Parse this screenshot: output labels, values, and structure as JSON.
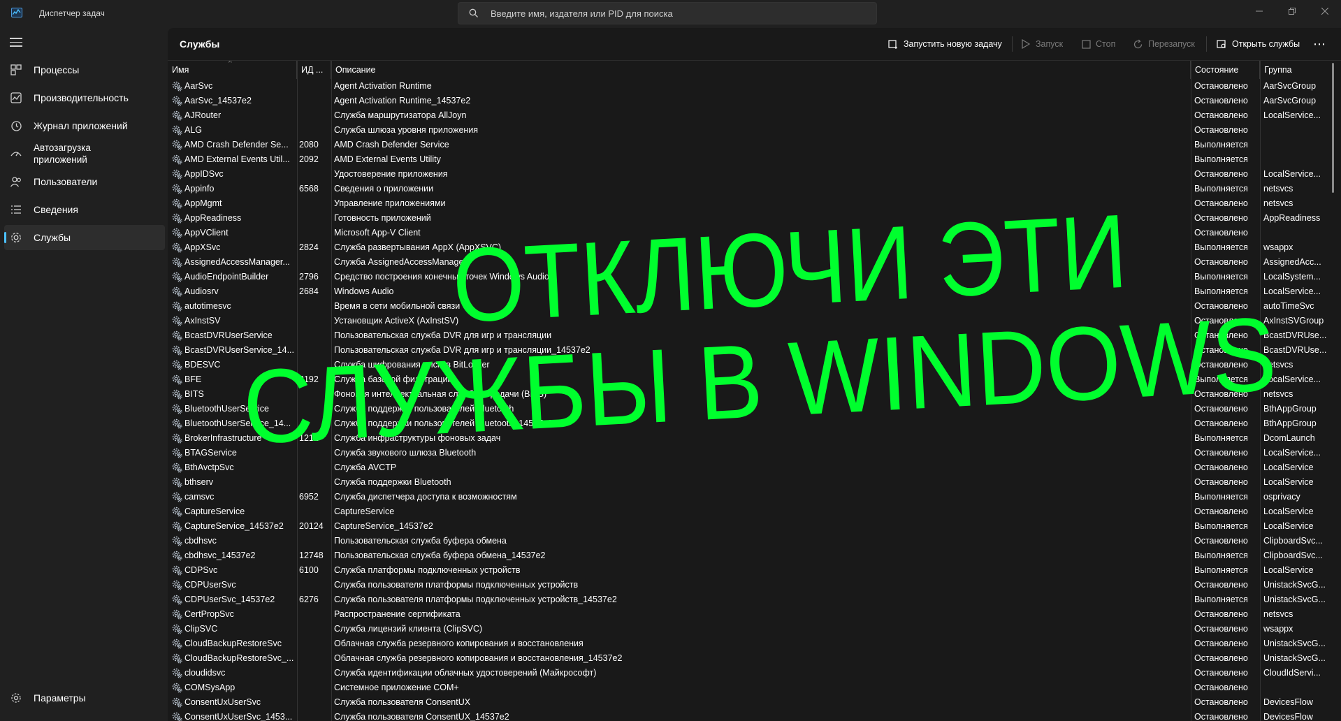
{
  "titlebar": {
    "app_title": "Диспетчер задач",
    "search_placeholder": "Введите имя, издателя или PID для поиска"
  },
  "sidebar": {
    "items": [
      {
        "label": "Процессы",
        "icon": "processes-icon"
      },
      {
        "label": "Производительность",
        "icon": "performance-icon"
      },
      {
        "label": "Журнал приложений",
        "icon": "app-history-icon"
      },
      {
        "label": "Автозагрузка приложений",
        "icon": "startup-icon"
      },
      {
        "label": "Пользователи",
        "icon": "users-icon"
      },
      {
        "label": "Сведения",
        "icon": "details-icon"
      },
      {
        "label": "Службы",
        "icon": "services-icon"
      }
    ],
    "settings_label": "Параметры"
  },
  "toolbar": {
    "title": "Службы",
    "run_new_task": "Запустить новую задачу",
    "start": "Запуск",
    "stop": "Стоп",
    "restart": "Перезапуск",
    "open_services": "Открыть службы",
    "more": "⋯"
  },
  "table": {
    "columns": [
      "Имя",
      "ИД ...",
      "Описание",
      "Состояние",
      "Группа"
    ],
    "rows": [
      [
        "AarSvc",
        "",
        "Agent Activation Runtime",
        "Остановлено",
        "AarSvcGroup"
      ],
      [
        "AarSvc_14537e2",
        "",
        "Agent Activation Runtime_14537e2",
        "Остановлено",
        "AarSvcGroup"
      ],
      [
        "AJRouter",
        "",
        "Служба маршрутизатора AllJoyn",
        "Остановлено",
        "LocalService..."
      ],
      [
        "ALG",
        "",
        "Служба шлюза уровня приложения",
        "Остановлено",
        ""
      ],
      [
        "AMD Crash Defender Se...",
        "2080",
        "AMD Crash Defender Service",
        "Выполняется",
        ""
      ],
      [
        "AMD External Events Util...",
        "2092",
        "AMD External Events Utility",
        "Выполняется",
        ""
      ],
      [
        "AppIDSvc",
        "",
        "Удостоверение приложения",
        "Остановлено",
        "LocalService..."
      ],
      [
        "Appinfo",
        "6568",
        "Сведения о приложении",
        "Выполняется",
        "netsvcs"
      ],
      [
        "AppMgmt",
        "",
        "Управление приложениями",
        "Остановлено",
        "netsvcs"
      ],
      [
        "AppReadiness",
        "",
        "Готовность приложений",
        "Остановлено",
        "AppReadiness"
      ],
      [
        "AppVClient",
        "",
        "Microsoft App-V Client",
        "Остановлено",
        ""
      ],
      [
        "AppXSvc",
        "2824",
        "Служба развертывания AppX (AppXSVC)",
        "Выполняется",
        "wsappx"
      ],
      [
        "AssignedAccessManager...",
        "",
        "Служба AssignedAccessManager",
        "Остановлено",
        "AssignedAcc..."
      ],
      [
        "AudioEndpointBuilder",
        "2796",
        "Средство построения конечных точек Windows Audio",
        "Выполняется",
        "LocalSystem..."
      ],
      [
        "Audiosrv",
        "2684",
        "Windows Audio",
        "Выполняется",
        "LocalService..."
      ],
      [
        "autotimesvc",
        "",
        "Время в сети мобильной связи",
        "Остановлено",
        "autoTimeSvc"
      ],
      [
        "AxInstSV",
        "",
        "Установщик ActiveX (AxInstSV)",
        "Остановлено",
        "AxInstSVGroup"
      ],
      [
        "BcastDVRUserService",
        "",
        "Пользовательская служба DVR для игр и трансляции",
        "Остановлено",
        "BcastDVRUse..."
      ],
      [
        "BcastDVRUserService_14...",
        "",
        "Пользовательская служба DVR для игр и трансляции_14537e2",
        "Остановлено",
        "BcastDVRUse..."
      ],
      [
        "BDESVC",
        "",
        "Служба шифрования дисков BitLocker",
        "Остановлено",
        "netsvcs"
      ],
      [
        "BFE",
        "3192",
        "Служба базовой фильтрации",
        "Выполняется",
        "LocalService..."
      ],
      [
        "BITS",
        "",
        "Фоновая интеллектуальная служба передачи (BITS)",
        "Остановлено",
        "netsvcs"
      ],
      [
        "BluetoothUserService",
        "",
        "Служба поддержки пользователей Bluetooth",
        "Остановлено",
        "BthAppGroup"
      ],
      [
        "BluetoothUserService_14...",
        "",
        "Служба поддержки пользователей Bluetooth_14537e2",
        "Остановлено",
        "BthAppGroup"
      ],
      [
        "BrokerInfrastructure",
        "1212",
        "Служба инфраструктуры фоновых задач",
        "Выполняется",
        "DcomLaunch"
      ],
      [
        "BTAGService",
        "",
        "Служба звукового шлюза Bluetooth",
        "Остановлено",
        "LocalService..."
      ],
      [
        "BthAvctpSvc",
        "",
        "Служба AVCTP",
        "Остановлено",
        "LocalService"
      ],
      [
        "bthserv",
        "",
        "Служба поддержки Bluetooth",
        "Остановлено",
        "LocalService"
      ],
      [
        "camsvc",
        "6952",
        "Служба диспетчера доступа к возможностям",
        "Выполняется",
        "osprivacy"
      ],
      [
        "CaptureService",
        "",
        "CaptureService",
        "Остановлено",
        "LocalService"
      ],
      [
        "CaptureService_14537e2",
        "20124",
        "CaptureService_14537e2",
        "Выполняется",
        "LocalService"
      ],
      [
        "cbdhsvc",
        "",
        "Пользовательская служба буфера обмена",
        "Остановлено",
        "ClipboardSvc..."
      ],
      [
        "cbdhsvc_14537e2",
        "12748",
        "Пользовательская служба буфера обмена_14537e2",
        "Выполняется",
        "ClipboardSvc..."
      ],
      [
        "CDPSvc",
        "6100",
        "Служба платформы подключенных устройств",
        "Выполняется",
        "LocalService"
      ],
      [
        "CDPUserSvc",
        "",
        "Служба пользователя платформы подключенных устройств",
        "Остановлено",
        "UnistackSvcG..."
      ],
      [
        "CDPUserSvc_14537e2",
        "6276",
        "Служба пользователя платформы подключенных устройств_14537e2",
        "Выполняется",
        "UnistackSvcG..."
      ],
      [
        "CertPropSvc",
        "",
        "Распространение сертификата",
        "Остановлено",
        "netsvcs"
      ],
      [
        "ClipSVC",
        "",
        "Служба лицензий клиента (ClipSVC)",
        "Остановлено",
        "wsappx"
      ],
      [
        "CloudBackupRestoreSvc",
        "",
        "Облачная служба резервного копирования и восстановления",
        "Остановлено",
        "UnistackSvcG..."
      ],
      [
        "CloudBackupRestoreSvc_...",
        "",
        "Облачная служба резервного копирования и восстановления_14537e2",
        "Остановлено",
        "UnistackSvcG..."
      ],
      [
        "cloudidsvc",
        "",
        "Служба идентификации облачных удостоверений (Майкрософт)",
        "Остановлено",
        "CloudIdServi..."
      ],
      [
        "COMSysApp",
        "",
        "Системное приложение COM+",
        "Остановлено",
        ""
      ],
      [
        "ConsentUxUserSvc",
        "",
        "Служба пользователя ConsentUX",
        "Остановлено",
        "DevicesFlow"
      ],
      [
        "ConsentUxUserSvc_1453...",
        "",
        "Служба пользователя ConsentUX_14537e2",
        "Остановлено",
        "DevicesFlow"
      ]
    ]
  },
  "overlay": {
    "line1": "ОТКЛЮЧИ ЭТИ",
    "line2": "СЛУЖБЫ В WINDOWS",
    "color": "#00ff2e"
  },
  "colors": {
    "accent": "#4cc2ff",
    "background": "#202020",
    "table_background": "#191919"
  }
}
